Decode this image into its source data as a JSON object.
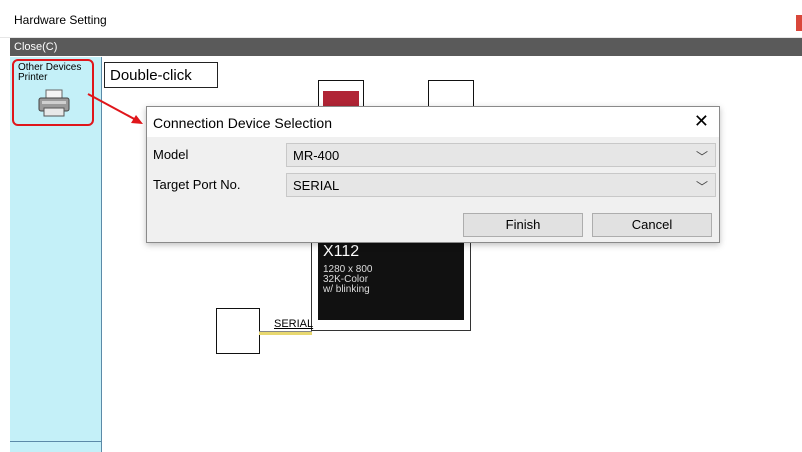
{
  "window": {
    "title": "Hardware Setting"
  },
  "menu": {
    "close_label": "Close(C)"
  },
  "sidebar": {
    "device_group": {
      "line1": "Other Devices",
      "line2": "Printer",
      "icon": "printer-icon"
    }
  },
  "callout": {
    "text": "Double-click"
  },
  "screen_device": {
    "model": "X112",
    "resolution": "1280 x 800",
    "colors": "32K-Color",
    "blink": "w/ blinking"
  },
  "connection": {
    "serial_label": "SERIAL"
  },
  "dialog": {
    "title": "Connection Device Selection",
    "close_glyph": "✕",
    "model_label": "Model",
    "model_value": "MR-400",
    "port_label": "Target Port No.",
    "port_value": "SERIAL",
    "finish_label": "Finish",
    "cancel_label": "Cancel",
    "chevron": "﹀"
  },
  "colors": {
    "highlight": "#e0161b",
    "sidebar_bg": "#c4f0f8",
    "menubar_bg": "#5a5a5a"
  }
}
